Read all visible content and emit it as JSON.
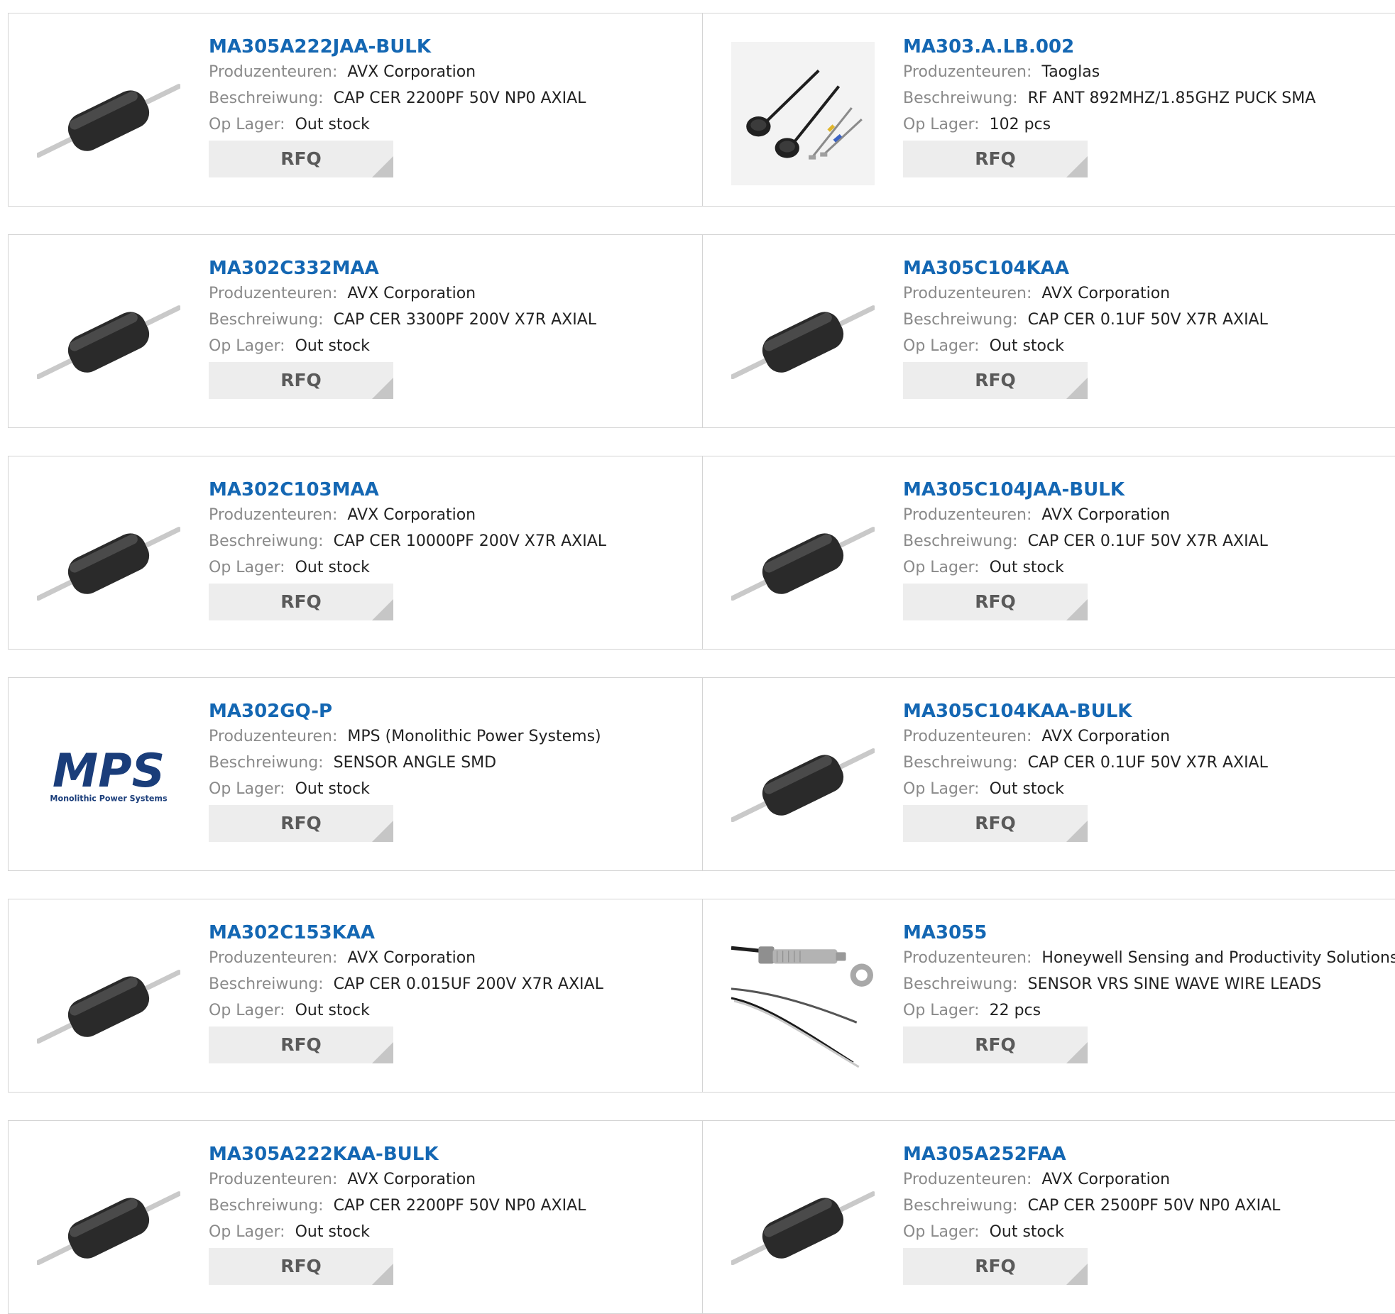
{
  "labels": {
    "manufacturer": "Produzenteuren:",
    "description": "Beschreiwung:",
    "stock": "Op Lager:",
    "rfq": "RFQ"
  },
  "products": [
    {
      "part": "MA305A222JAA-BULK",
      "manufacturer": "AVX Corporation",
      "description": "CAP CER 2200PF 50V NP0 AXIAL",
      "stock": "Out stock",
      "image": "axial-capacitor-image"
    },
    {
      "part": "MA303.A.LB.002",
      "manufacturer": "Taoglas",
      "description": "RF ANT 892MHZ/1.85GHZ PUCK SMA",
      "stock": "102 pcs",
      "image": "puck-antenna-image"
    },
    {
      "part": "MA302C332MAA",
      "manufacturer": "AVX Corporation",
      "description": "CAP CER 3300PF 200V X7R AXIAL",
      "stock": "Out stock",
      "image": "axial-capacitor-image"
    },
    {
      "part": "MA305C104KAA",
      "manufacturer": "AVX Corporation",
      "description": "CAP CER 0.1UF 50V X7R AXIAL",
      "stock": "Out stock",
      "image": "axial-capacitor-image"
    },
    {
      "part": "MA302C103MAA",
      "manufacturer": "AVX Corporation",
      "description": "CAP CER 10000PF 200V X7R AXIAL",
      "stock": "Out stock",
      "image": "axial-capacitor-image"
    },
    {
      "part": "MA305C104JAA-BULK",
      "manufacturer": "AVX Corporation",
      "description": "CAP CER 0.1UF 50V X7R AXIAL",
      "stock": "Out stock",
      "image": "axial-capacitor-image"
    },
    {
      "part": "MA302GQ-P",
      "manufacturer": "MPS (Monolithic Power Systems)",
      "description": "SENSOR ANGLE SMD",
      "stock": "Out stock",
      "image": "mps-logo-image",
      "logo_text": "MPS",
      "logo_caption": "Monolithic Power Systems"
    },
    {
      "part": "MA305C104KAA-BULK",
      "manufacturer": "AVX Corporation",
      "description": "CAP CER 0.1UF 50V X7R AXIAL",
      "stock": "Out stock",
      "image": "axial-capacitor-image"
    },
    {
      "part": "MA302C153KAA",
      "manufacturer": "AVX Corporation",
      "description": "CAP CER 0.015UF 200V X7R AXIAL",
      "stock": "Out stock",
      "image": "axial-capacitor-image"
    },
    {
      "part": "MA3055",
      "manufacturer": "Honeywell Sensing and Productivity Solutions",
      "description": "SENSOR VRS SINE WAVE WIRE LEADS",
      "stock": "22 pcs",
      "image": "vrs-sensor-image"
    },
    {
      "part": "MA305A222KAA-BULK",
      "manufacturer": "AVX Corporation",
      "description": "CAP CER 2200PF 50V NP0 AXIAL",
      "stock": "Out stock",
      "image": "axial-capacitor-image"
    },
    {
      "part": "MA305A252FAA",
      "manufacturer": "AVX Corporation",
      "description": "CAP CER 2500PF 50V NP0 AXIAL",
      "stock": "Out stock",
      "image": "axial-capacitor-image"
    }
  ],
  "colors": {
    "title": "#1467b3",
    "label": "#8a8a8a",
    "value": "#222222",
    "button_bg": "#ededed",
    "button_corner": "#c6c6c6",
    "border": "#d4d4d4",
    "mps_blue": "#1a3d7a"
  }
}
